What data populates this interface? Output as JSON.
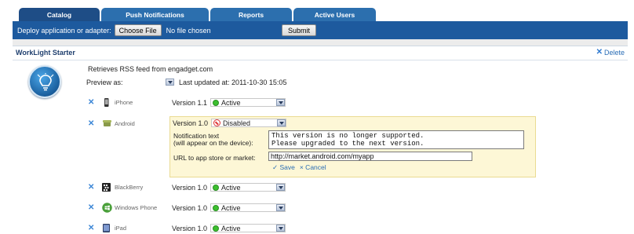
{
  "tabs": [
    {
      "label": "Catalog"
    },
    {
      "label": "Push Notifications"
    },
    {
      "label": "Reports"
    },
    {
      "label": "Active Users"
    }
  ],
  "deploy": {
    "label": "Deploy application or adapter:",
    "choose_file": "Choose File",
    "no_file": "No file chosen",
    "submit": "Submit"
  },
  "app": {
    "title": "WorkLight Starter",
    "delete_label": "Delete",
    "description": "Retrieves RSS feed from engadget.com",
    "preview_value": "Preview as:",
    "last_updated": "Last updated at: 2011-10-30 15:05"
  },
  "environments": [
    {
      "name": "iPhone",
      "version": "Version 1.1",
      "status": "Active",
      "icon": "iphone-icon"
    },
    {
      "name": "Android",
      "version": "Version 1.0",
      "status": "Disabled",
      "icon": "android-icon"
    },
    {
      "name": "BlackBerry",
      "version": "Version 1.0",
      "status": "Active",
      "icon": "blackberry-icon"
    },
    {
      "name": "Windows Phone",
      "version": "Version 1.0",
      "status": "Active",
      "icon": "windows-phone-icon"
    },
    {
      "name": "iPad",
      "version": "Version 1.0",
      "status": "Active",
      "icon": "ipad-icon"
    }
  ],
  "disable_form": {
    "notification_label_1": "Notification text",
    "notification_label_2": "(will appear on the device):",
    "notification_text": "This version is no longer supported.\nPlease upgraded to the next version.",
    "url_label": "URL to app store or market:",
    "url_value": "http://market.android.com/myapp",
    "save": "✓ Save",
    "cancel": "× Cancel"
  },
  "colors": {
    "tab": "#2c6fae",
    "tab_active": "#1e4d86",
    "deploy_bar": "#1d5a9e",
    "active_dot": "#3cbf2f",
    "disabled": "#dd3333",
    "edit_bg": "#fdf7d6"
  }
}
